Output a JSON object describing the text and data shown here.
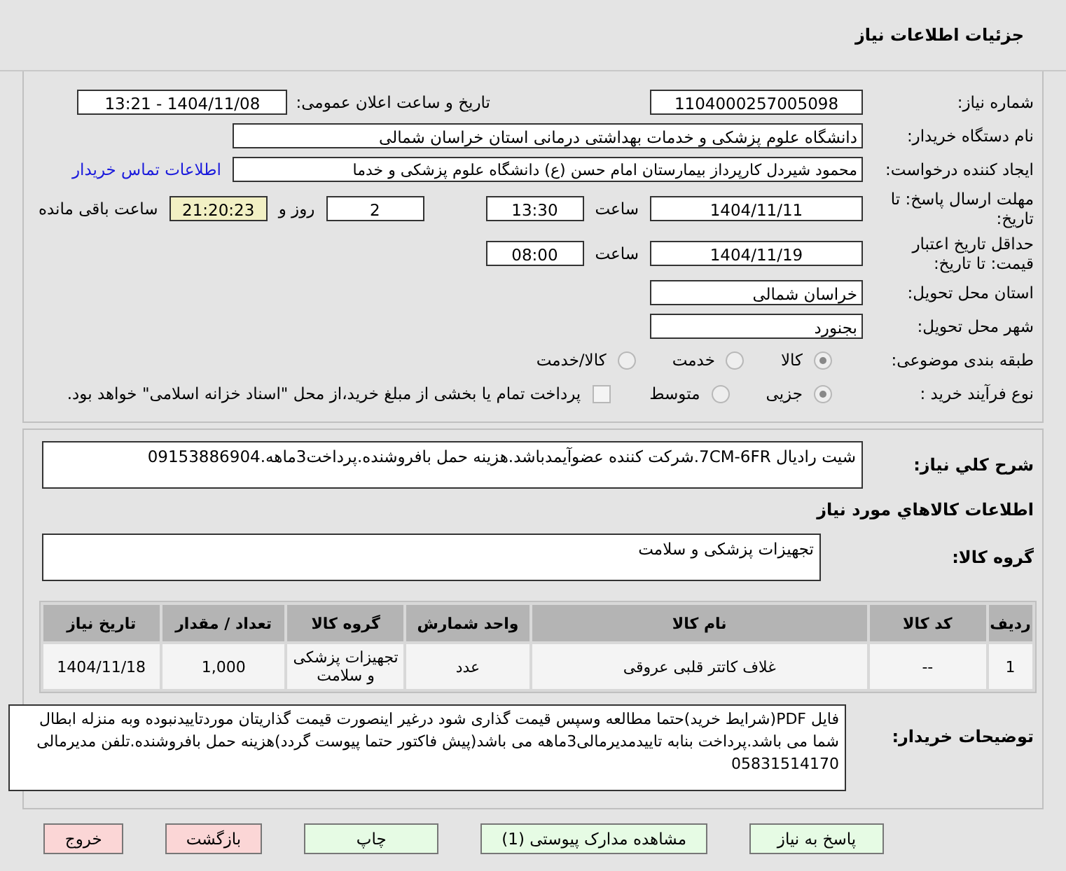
{
  "header": {
    "title": "جزئیات اطلاعات نیاز"
  },
  "need_number": {
    "label": "شماره نیاز:",
    "value": "1104000257005098"
  },
  "announce": {
    "label": "تاریخ و ساعت اعلان عمومی:",
    "value": "1404/11/08 - 13:21"
  },
  "buyer_org": {
    "label": "نام دستگاه خریدار:",
    "value": "دانشگاه علوم پزشکی و خدمات بهداشتی درمانی استان خراسان شمالی"
  },
  "requester": {
    "label": "ایجاد کننده درخواست:",
    "value": "محمود شیردل کارپرداز بیمارستان امام حسن (ع) دانشگاه علوم پزشکی و خدما",
    "link": "اطلاعات تماس خریدار"
  },
  "deadline": {
    "label": "مهلت ارسال پاسخ: تا تاریخ:",
    "date": "1404/11/11",
    "time_label": "ساعت",
    "time": "13:30",
    "days": "2",
    "days_label": "روز و",
    "remaining": "21:20:23",
    "remaining_label": "ساعت باقی مانده"
  },
  "validity": {
    "label": "حداقل تاریخ اعتبار قیمت: تا تاریخ:",
    "date": "1404/11/19",
    "time_label": "ساعت",
    "time": "08:00"
  },
  "province": {
    "label": "استان محل تحویل:",
    "value": "خراسان شمالی"
  },
  "city": {
    "label": "شهر محل تحویل:",
    "value": "بجنورد"
  },
  "category": {
    "label": "طبقه بندی موضوعی:",
    "options": [
      {
        "label": "کالا",
        "selected": true
      },
      {
        "label": "خدمت",
        "selected": false
      },
      {
        "label": "کالا/خدمت",
        "selected": false
      }
    ]
  },
  "process": {
    "label": "نوع فرآیند خرید :",
    "options": [
      {
        "label": "جزیی",
        "selected": true
      },
      {
        "label": "متوسط",
        "selected": false
      }
    ],
    "checkbox": {
      "label": "پرداخت تمام یا بخشی از مبلغ خرید،از محل \"اسناد خزانه اسلامی\" خواهد بود.",
      "checked": false
    }
  },
  "summary": {
    "label": "شرح کلي نياز:",
    "value": "شیت رادیال 7CM-6FR.شرکت کننده عضوآیمدباشد.هزینه حمل بافروشنده.پرداخت3ماهه.09153886904"
  },
  "goods_title": "اطلاعات کالاهاي مورد نياز",
  "goods_group": {
    "label": "گروه کالا:",
    "value": "تجهیزات پزشکی و سلامت"
  },
  "table": {
    "columns": [
      "ردیف",
      "کد کالا",
      "نام کالا",
      "واحد شمارش",
      "گروه کالا",
      "تعداد / مقدار",
      "تاریخ نیاز"
    ],
    "rows": [
      [
        "1",
        "--",
        "غلاف کاتتر قلبی عروقی",
        "عدد",
        "تجهیزات پزشکی و سلامت",
        "1,000",
        "1404/11/18"
      ]
    ]
  },
  "buyer_notes": {
    "label": "توضیحات خریدار:",
    "value": "فایل PDF(شرایط خرید)حتما مطالعه وسپس قیمت گذاری شود درغیر اینصورت قیمت گذاریتان موردتاییدنبوده وبه منزله ابطال شما می باشد.پرداخت بنابه تاییدمدیرمالی3ماهه می باشد(پیش فاکتور حتما پیوست گردد)هزینه حمل بافروشنده.تلفن مدیرمالی 05831514170"
  },
  "buttons": [
    {
      "label": "پاسخ به نیاز",
      "kind": "go"
    },
    {
      "label": "مشاهده مدارک پیوستی (1)",
      "kind": "go"
    },
    {
      "label": "چاپ",
      "kind": "go"
    },
    {
      "label": "بازگشت",
      "kind": "stop"
    },
    {
      "label": "خروج",
      "kind": "stop"
    }
  ]
}
